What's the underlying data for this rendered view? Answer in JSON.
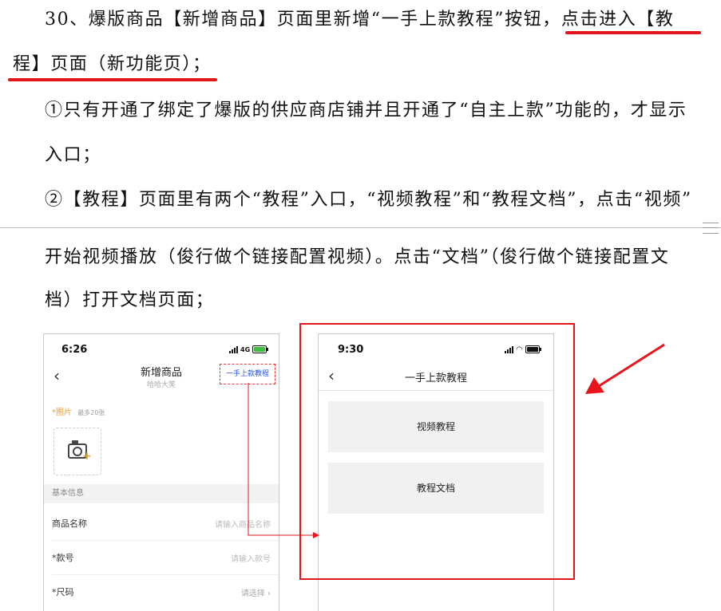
{
  "doc": {
    "line1": "30、爆版商品【新增商品】页面里新增“一手上款教程”按钮，点击进入【教",
    "line2": "程】页面（新功能页）；",
    "line3": "①只有开通了绑定了爆版的供应商店铺并且开通了“自主上款”功能的，才显示",
    "line4": "入口；",
    "line5": "②【教程】页面里有两个“教程”入口，“视频教程”和“教程文档”，点击“视频”",
    "line6": "开始视频播放（俊行做个链接配置视频）。点击“文档”（俊行做个链接配置文",
    "line7": "档）打开文档页面；"
  },
  "phone_left": {
    "time": "6:26",
    "network": "4G",
    "title": "新增商品",
    "subtitle": "哈哈大笑",
    "tutorial_button": "一手上款教程",
    "photo_label": "*图片",
    "photo_hint": "最多20张",
    "section_basic": "基本信息",
    "rows": [
      {
        "label": "商品名称",
        "placeholder": "请输入商品名称",
        "required": false
      },
      {
        "label": "*款号",
        "placeholder": "请输入款号",
        "required": true
      },
      {
        "label": "*尺码",
        "placeholder": "请选择 ›",
        "required": true
      }
    ]
  },
  "phone_right": {
    "time": "9:30",
    "title": "一手上款教程",
    "items": [
      "视频教程",
      "教程文档"
    ]
  },
  "colors": {
    "annotation_red": "#e8141c",
    "link_blue": "#2d56e0",
    "required_orange": "#e4a03c"
  }
}
